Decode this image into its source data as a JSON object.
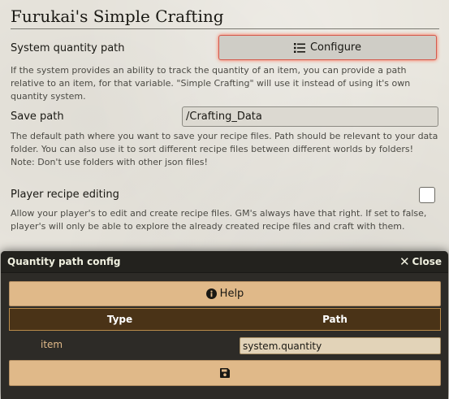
{
  "settings": {
    "title": "Furukai's Simple Crafting",
    "quantity_path": {
      "label": "System quantity path",
      "button_label": "Configure",
      "button_icon": "list-icon",
      "hint": "If the system provides an ability to track the quantity of an item, you can provide a path relative to an item, for that variable. \"Simple Crafting\" will use it instead of using it's own quantity system."
    },
    "save_path": {
      "label": "Save path",
      "value": "/Crafting_Data",
      "hint": "The default path where you want to save your recipe files. Path should be relevant to your data folder. You can also use it to sort different recipe files between different worlds by folders! Note: Don't use folders with other json files!"
    },
    "player_editing": {
      "label": "Player recipe editing",
      "checked": false,
      "hint": "Allow your player's to edit and create recipe files. GM's always have that right. If set to false, player's will only be able to explore the already created recipe files and craft with them."
    }
  },
  "dialog": {
    "title": "Quantity path config",
    "close_label": "Close",
    "help_label": "Help",
    "help_icon": "info-circle-icon",
    "table": {
      "headers": [
        "Type",
        "Path"
      ],
      "rows": [
        {
          "type": "item",
          "path": "system.quantity"
        }
      ]
    },
    "save_icon": "floppy-disk-icon"
  },
  "colors": {
    "accent_button": "#e0b989",
    "table_header": "#4a3317",
    "dialog_bg": "#2d2b27",
    "focus_glow": "#ff6a4d"
  }
}
